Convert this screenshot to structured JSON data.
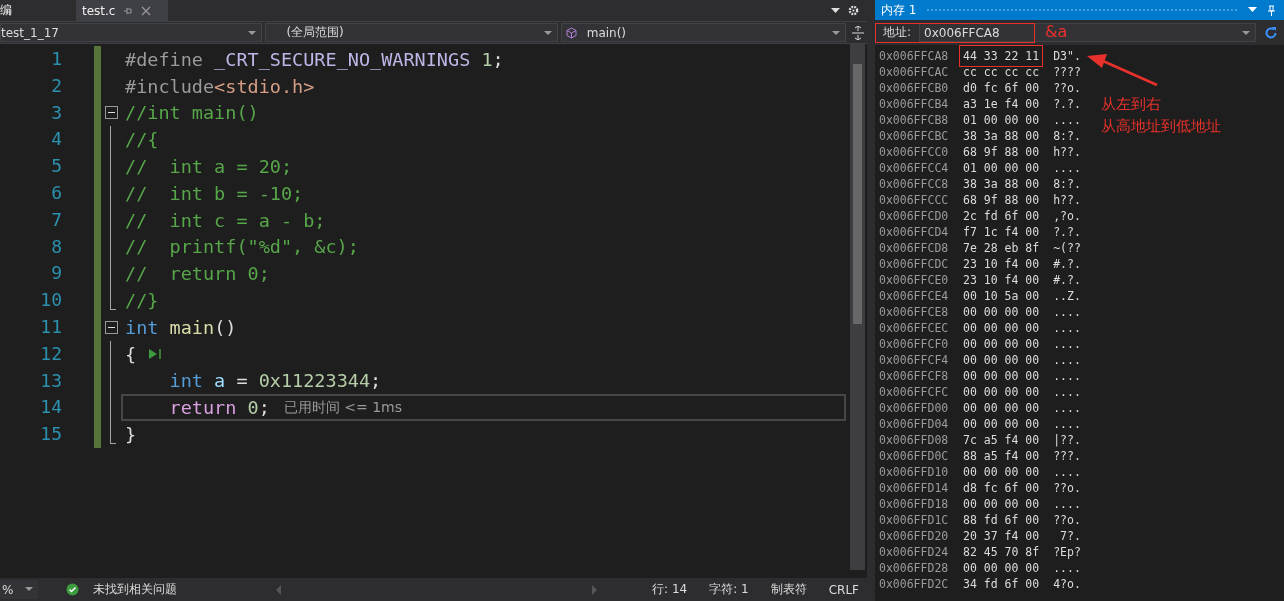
{
  "tabs": [
    {
      "label": "编",
      "selected": false
    },
    {
      "label": "test.c",
      "selected": true
    }
  ],
  "navigation": {
    "project": "test_1_17",
    "scope": "(全局范围)",
    "member": "main()"
  },
  "editor": {
    "lines": [
      {
        "number": "1",
        "current": false,
        "tokens": [
          {
            "kind": "preproc",
            "text": "#define "
          },
          {
            "kind": "macro",
            "text": "_CRT_SECURE_NO_WARNINGS"
          },
          {
            "kind": "number",
            "text": " 1"
          },
          {
            "kind": "plain",
            "text": ";"
          }
        ]
      },
      {
        "number": "2",
        "current": false,
        "tokens": [
          {
            "kind": "preproc",
            "text": "#include"
          },
          {
            "kind": "path",
            "text": "<stdio.h>"
          }
        ]
      },
      {
        "number": "3",
        "current": false,
        "expanded": true,
        "tokens": [
          {
            "kind": "comment",
            "text": "//int main()"
          }
        ],
        "children": [
          {
            "number": "4",
            "current": false,
            "tokens": [
              {
                "kind": "comment",
                "text": "//{"
              }
            ]
          },
          {
            "number": "5",
            "current": false,
            "tokens": [
              {
                "kind": "comment",
                "text": "//  int a = 20;"
              }
            ]
          },
          {
            "number": "6",
            "current": false,
            "tokens": [
              {
                "kind": "comment",
                "text": "//  int b = -10;"
              }
            ]
          },
          {
            "number": "7",
            "current": false,
            "tokens": [
              {
                "kind": "comment",
                "text": "//  int c = a - b;"
              }
            ]
          },
          {
            "number": "8",
            "current": false,
            "tokens": [
              {
                "kind": "comment",
                "text": "//  printf(\"%d\", &c);"
              }
            ]
          },
          {
            "number": "9",
            "current": false,
            "tokens": [
              {
                "kind": "comment",
                "text": "//  return 0;"
              }
            ]
          },
          {
            "number": "10",
            "current": false,
            "tokens": [
              {
                "kind": "comment",
                "text": "//}"
              }
            ]
          }
        ]
      },
      {
        "number": "11",
        "current": false,
        "expanded": true,
        "tokens": [
          {
            "kind": "keyword",
            "text": "int"
          },
          {
            "kind": "function",
            "text": " main"
          },
          {
            "kind": "plain",
            "text": "()"
          }
        ],
        "children": [
          {
            "number": "12",
            "current": false,
            "run_marker": true,
            "tokens": [
              {
                "kind": "plain",
                "text": "{"
              }
            ]
          },
          {
            "number": "13",
            "current": false,
            "tokens": [
              {
                "kind": "keyword",
                "text": "    int"
              },
              {
                "kind": "variable",
                "text": " a"
              },
              {
                "kind": "plain",
                "text": " = "
              },
              {
                "kind": "number",
                "text": "0x11223344"
              },
              {
                "kind": "plain",
                "text": ";"
              }
            ]
          },
          {
            "number": "14",
            "current": true,
            "hint": "已用时间 <= 1ms",
            "tokens": [
              {
                "kind": "control",
                "text": "    return"
              },
              {
                "kind": "number",
                "text": " 0"
              },
              {
                "kind": "plain",
                "text": ";"
              }
            ]
          },
          {
            "number": "15",
            "current": false,
            "tokens": [
              {
                "kind": "plain",
                "text": "}"
              }
            ]
          }
        ]
      }
    ]
  },
  "status_bar": {
    "zoom": "%",
    "issues": "未找到相关问题",
    "line": "行: 14",
    "column": "字符: 1",
    "indent": "制表符",
    "line_ending": "CRLF"
  },
  "memory_window": {
    "title": "内存 1",
    "address_label": "地址:",
    "address": "0x006FFCA8",
    "rows": [
      {
        "address": "0x006FFCA8",
        "bytes": "44 33 22 11",
        "ascii": "D3\".",
        "marked": true
      },
      {
        "address": "0x006FFCAC",
        "bytes": "cc cc cc cc",
        "ascii": "????",
        "marked": false
      },
      {
        "address": "0x006FFCB0",
        "bytes": "d0 fc 6f 00",
        "ascii": "??o.",
        "marked": false
      },
      {
        "address": "0x006FFCB4",
        "bytes": "a3 1e f4 00",
        "ascii": "?.?.",
        "marked": false
      },
      {
        "address": "0x006FFCB8",
        "bytes": "01 00 00 00",
        "ascii": "....",
        "marked": false
      },
      {
        "address": "0x006FFCBC",
        "bytes": "38 3a 88 00",
        "ascii": "8:?.",
        "marked": false
      },
      {
        "address": "0x006FFCC0",
        "bytes": "68 9f 88 00",
        "ascii": "h??.",
        "marked": false
      },
      {
        "address": "0x006FFCC4",
        "bytes": "01 00 00 00",
        "ascii": "....",
        "marked": false
      },
      {
        "address": "0x006FFCC8",
        "bytes": "38 3a 88 00",
        "ascii": "8:?.",
        "marked": false
      },
      {
        "address": "0x006FFCCC",
        "bytes": "68 9f 88 00",
        "ascii": "h??.",
        "marked": false
      },
      {
        "address": "0x006FFCD0",
        "bytes": "2c fd 6f 00",
        "ascii": ",?o.",
        "marked": false
      },
      {
        "address": "0x006FFCD4",
        "bytes": "f7 1c f4 00",
        "ascii": "?.?.",
        "marked": false
      },
      {
        "address": "0x006FFCD8",
        "bytes": "7e 28 eb 8f",
        "ascii": "~(??",
        "marked": false
      },
      {
        "address": "0x006FFCDC",
        "bytes": "23 10 f4 00",
        "ascii": "#.?.",
        "marked": false
      },
      {
        "address": "0x006FFCE0",
        "bytes": "23 10 f4 00",
        "ascii": "#.?.",
        "marked": false
      },
      {
        "address": "0x006FFCE4",
        "bytes": "00 10 5a 00",
        "ascii": "..Z.",
        "marked": false
      },
      {
        "address": "0x006FFCE8",
        "bytes": "00 00 00 00",
        "ascii": "....",
        "marked": false
      },
      {
        "address": "0x006FFCEC",
        "bytes": "00 00 00 00",
        "ascii": "....",
        "marked": false
      },
      {
        "address": "0x006FFCF0",
        "bytes": "00 00 00 00",
        "ascii": "....",
        "marked": false
      },
      {
        "address": "0x006FFCF4",
        "bytes": "00 00 00 00",
        "ascii": "....",
        "marked": false
      },
      {
        "address": "0x006FFCF8",
        "bytes": "00 00 00 00",
        "ascii": "....",
        "marked": false
      },
      {
        "address": "0x006FFCFC",
        "bytes": "00 00 00 00",
        "ascii": "....",
        "marked": false
      },
      {
        "address": "0x006FFD00",
        "bytes": "00 00 00 00",
        "ascii": "....",
        "marked": false
      },
      {
        "address": "0x006FFD04",
        "bytes": "00 00 00 00",
        "ascii": "....",
        "marked": false
      },
      {
        "address": "0x006FFD08",
        "bytes": "7c a5 f4 00",
        "ascii": "|??.",
        "marked": false
      },
      {
        "address": "0x006FFD0C",
        "bytes": "88 a5 f4 00",
        "ascii": "???.",
        "marked": false
      },
      {
        "address": "0x006FFD10",
        "bytes": "00 00 00 00",
        "ascii": "....",
        "marked": false
      },
      {
        "address": "0x006FFD14",
        "bytes": "d8 fc 6f 00",
        "ascii": "??o.",
        "marked": false
      },
      {
        "address": "0x006FFD18",
        "bytes": "00 00 00 00",
        "ascii": "....",
        "marked": false
      },
      {
        "address": "0x006FFD1C",
        "bytes": "88 fd 6f 00",
        "ascii": "??o.",
        "marked": false
      },
      {
        "address": "0x006FFD20",
        "bytes": "20 37 f4 00",
        "ascii": " 7?.",
        "marked": false
      },
      {
        "address": "0x006FFD24",
        "bytes": "82 45 70 8f",
        "ascii": "?Ep?",
        "marked": false
      },
      {
        "address": "0x006FFD28",
        "bytes": "00 00 00 00",
        "ascii": "....",
        "marked": false
      },
      {
        "address": "0x006FFD2C",
        "bytes": "34 fd 6f 00",
        "ascii": "4?o.",
        "marked": false
      }
    ]
  },
  "annotations": {
    "address_label": "&a",
    "note_lines": [
      "从左到右",
      "从高地址到低地址"
    ]
  }
}
